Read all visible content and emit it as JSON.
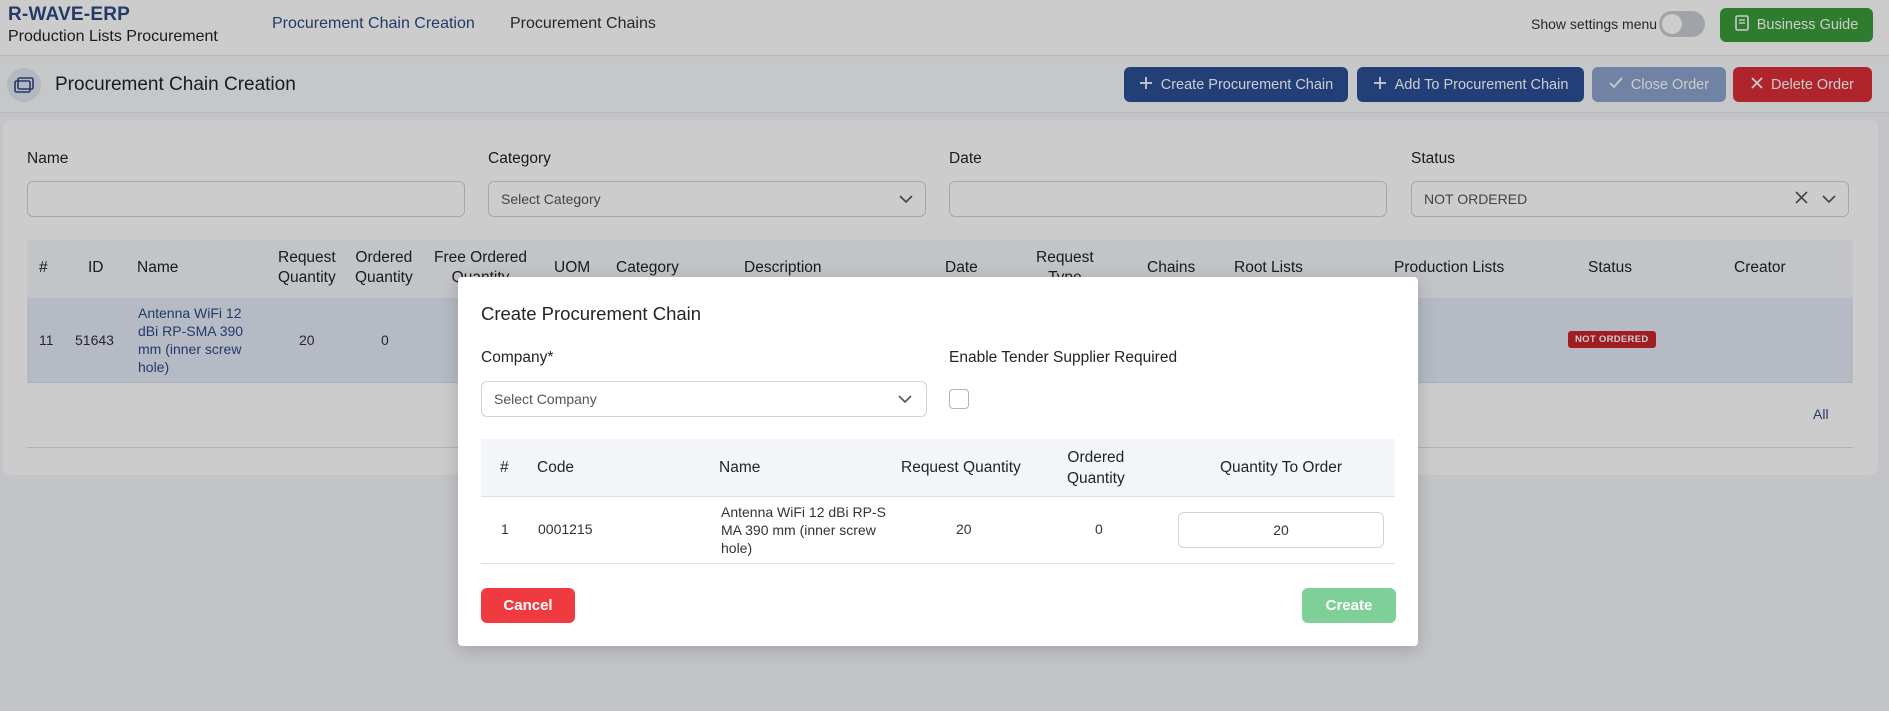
{
  "app": {
    "name": "R-WAVE-ERP",
    "module": "Production Lists Procurement"
  },
  "nav": [
    {
      "label": "Procurement Chain Creation",
      "active": true
    },
    {
      "label": "Procurement Chains",
      "active": false
    }
  ],
  "header": {
    "settings_label": "Show settings menu",
    "settings_enabled": false,
    "guide_label": "Business Guide"
  },
  "page": {
    "title": "Procurement Chain Creation",
    "actions": {
      "create_chain": "Create Procurement Chain",
      "add_to_chain": "Add To Procurement Chain",
      "close_order": "Close Order",
      "delete_order": "Delete Order"
    }
  },
  "filters": {
    "name": {
      "label": "Name",
      "value": ""
    },
    "category": {
      "label": "Category",
      "placeholder": "Select Category"
    },
    "date": {
      "label": "Date",
      "value": ""
    },
    "status": {
      "label": "Status",
      "value": "NOT ORDERED"
    }
  },
  "table": {
    "headers": {
      "index": "#",
      "id": "ID",
      "name": "Name",
      "request_qty": [
        "Request",
        "Quantity"
      ],
      "ordered_qty": [
        "Ordered",
        "Quantity"
      ],
      "free_ordered_qty": [
        "Free Ordered",
        "Quantity"
      ],
      "uom": "UOM",
      "category": "Category",
      "description": "Description",
      "date": "Date",
      "request_type": [
        "Request",
        "Type"
      ],
      "chains": "Chains",
      "root_lists": "Root Lists",
      "production_lists": "Production Lists",
      "status": "Status",
      "creator": "Creator"
    },
    "rows": [
      {
        "index": "11",
        "id": "51643",
        "name": [
          "Antenna WiFi 12",
          "dBi RP-SMA 390",
          "mm (inner screw",
          "hole)"
        ],
        "request_qty": "20",
        "ordered_qty": "0",
        "status": "NOT ORDERED"
      }
    ],
    "footer_link": "All"
  },
  "modal": {
    "title": "Create Procurement Chain",
    "company_label": "Company*",
    "company_placeholder": "Select Company",
    "tender_label": "Enable Tender Supplier Required",
    "tender_checked": false,
    "headers": {
      "index": "#",
      "code": "Code",
      "name": "Name",
      "request_qty": "Request Quantity",
      "ordered_qty": [
        "Ordered",
        "Quantity"
      ],
      "qty_to_order": "Quantity To Order"
    },
    "rows": [
      {
        "index": "1",
        "code": "0001215",
        "name": [
          "Antenna WiFi 12 dBi RP-S",
          "MA 390 mm (inner screw",
          "hole)"
        ],
        "request_qty": "20",
        "ordered_qty": "0",
        "qty_to_order": "20"
      }
    ],
    "cancel_label": "Cancel",
    "create_label": "Create"
  },
  "colors": {
    "brand": "#2c4a84",
    "primary": "#2c4f96",
    "danger": "#dc2f36",
    "success": "#3a9d3a",
    "create_disabled": "#7fcf99"
  }
}
